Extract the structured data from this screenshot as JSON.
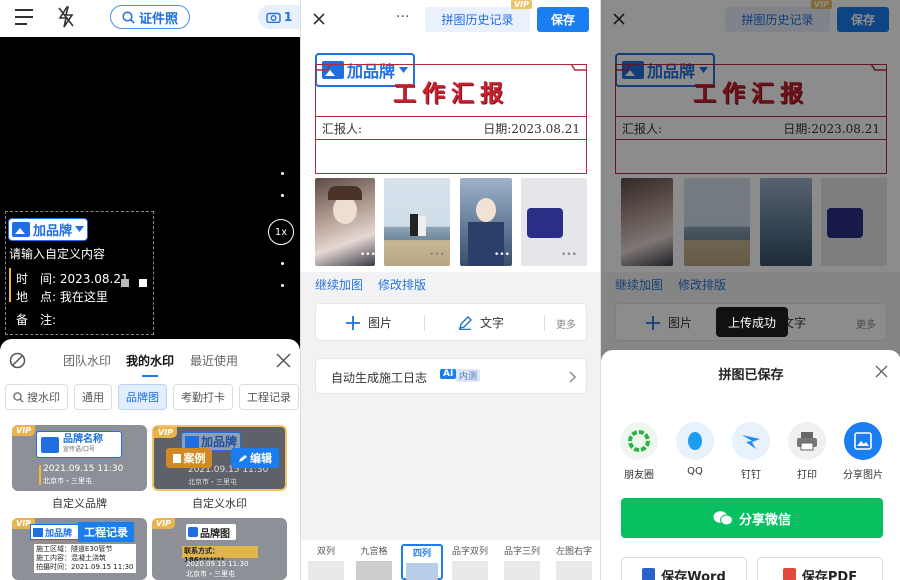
{
  "camera": {
    "id_photo_label": "证件照",
    "camera_count": "1",
    "zoom_label": "1x",
    "brand_label": "加品牌",
    "custom_text": "请输入自定义内容",
    "time_label": "时　间:",
    "time_value": "2023.08.21",
    "place_label": "地　点:",
    "place_value": "我在这里",
    "note_label": "备　注:",
    "tabs": [
      "团队水印",
      "我的水印",
      "最近使用"
    ],
    "search_label": "搜水印",
    "chips": [
      "通用",
      "品牌图",
      "考勤打卡",
      "工程记录"
    ],
    "cards": [
      {
        "vip": "VIP",
        "brand": "品牌名称",
        "brand_sub": "宣传语/口号",
        "date": "2021.09.15 11:30",
        "place": "北京市・三里屯",
        "caption": "自定义品牌"
      },
      {
        "vip": "VIP",
        "brand": "加品牌",
        "brand_sub": "字",
        "date": "2021.09.15 11:30",
        "place": "北京市・三里屯",
        "case_label": "案例",
        "edit_label": "编辑",
        "caption": "自定义水印"
      },
      {
        "vip": "VIP",
        "brand": "加品牌",
        "tag": "工程记录",
        "line1": "施工区域：隧道E30管节",
        "line2": "施工内容：混凝土浇筑",
        "line3": "拍摄时间：2021.09.15 11:30"
      },
      {
        "vip": "VIP",
        "brand": "品牌图",
        "phone": "联系方式：186*******",
        "date": "2020.09.15 11:30",
        "place": "北京市・三里屯"
      }
    ]
  },
  "editor": {
    "more_label": "···",
    "history_label": "拼图历史记录",
    "vip_label": "VIP",
    "save_label": "保存",
    "brand_label": "加品牌",
    "report_title": "工作汇报",
    "reporter_label": "汇报人:",
    "date_label": "日期:2023.08.21",
    "continue_label": "继续加图",
    "relayout_label": "修改排版",
    "image_label": "图片",
    "text_label": "文字",
    "more_tools_label": "更多",
    "auto_log_label": "自动生成施工日志",
    "ai_label": "AI",
    "beta_label": "内测",
    "layouts": [
      "双列",
      "九宫格",
      "四列",
      "品字双列",
      "品字三列",
      "左图右字"
    ]
  },
  "share": {
    "history_label": "拼图历史记录",
    "vip_label": "VIP",
    "save_label": "保存",
    "brand_label": "加品牌",
    "report_title": "工作汇报",
    "reporter_label": "汇报人:",
    "date_label": "日期:2023.08.21",
    "continue_label": "继续加图",
    "relayout_label": "修改排版",
    "image_label": "图片",
    "text_label": "文字",
    "more_tools_label": "更多",
    "toast": "上传成功",
    "modal_title": "拼图已保存",
    "targets": [
      "朋友圈",
      "QQ",
      "钉钉",
      "打印",
      "分享图片"
    ],
    "wechat_label": "分享微信",
    "word_label": "保存Word",
    "pdf_label": "保存PDF"
  },
  "colors": {
    "primary": "#1a7df0",
    "report_red": "#c8202e",
    "wechat": "#07c160",
    "vip": "#e9b44c"
  }
}
